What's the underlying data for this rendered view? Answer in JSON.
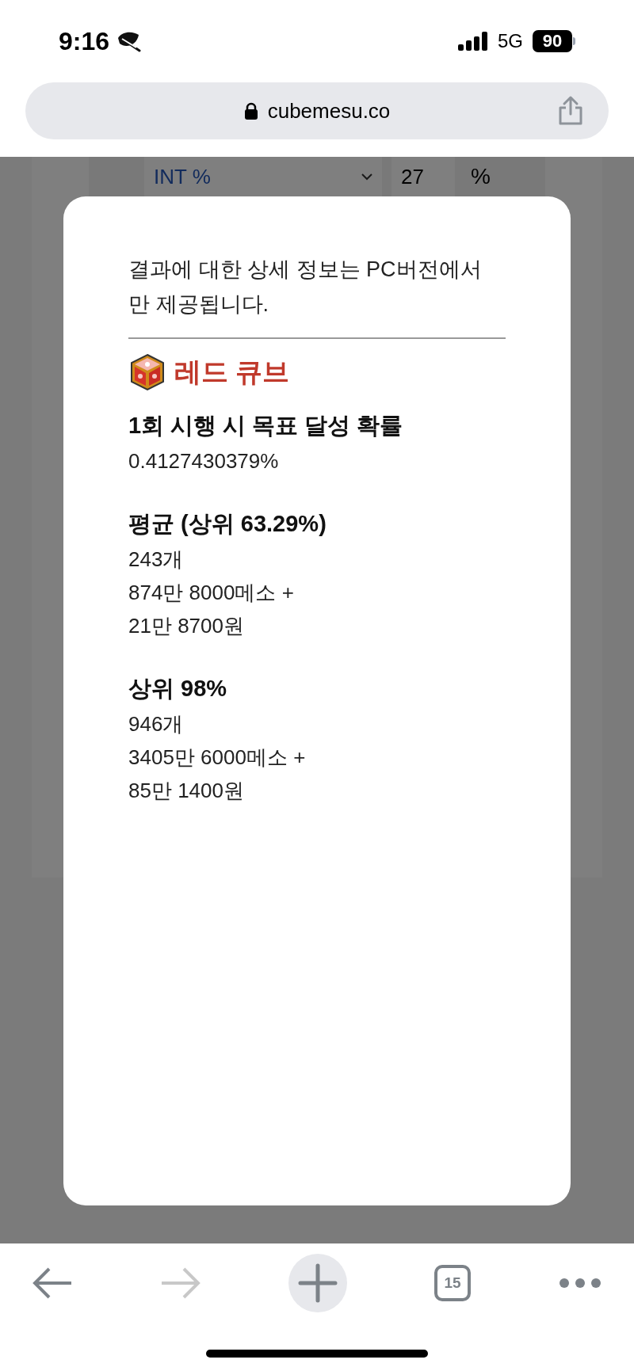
{
  "status_bar": {
    "time": "9:16",
    "network": "5G",
    "battery": "90"
  },
  "address_bar": {
    "url": "cubemesu.co"
  },
  "background_form": {
    "stat_select": "INT %",
    "value_field": "27",
    "unit": "%"
  },
  "modal": {
    "notice": "결과에 대한 상세 정보는 PC버전에서만 제공됩니다.",
    "title": "레드 큐브",
    "sections": [
      {
        "heading": "1회 시행 시 목표 달성 확률",
        "lines": [
          "0.4127430379%"
        ]
      },
      {
        "heading": "평균 (상위 63.29%)",
        "lines": [
          "243개",
          "874만 8000메소 +",
          "21만 8700원"
        ]
      },
      {
        "heading": "상위 98%",
        "lines": [
          "946개",
          "3405만 6000메소 +",
          "85만 1400원"
        ]
      }
    ]
  },
  "toolbar": {
    "back_disabled": false,
    "forward_disabled": true,
    "tab_count": "15"
  }
}
